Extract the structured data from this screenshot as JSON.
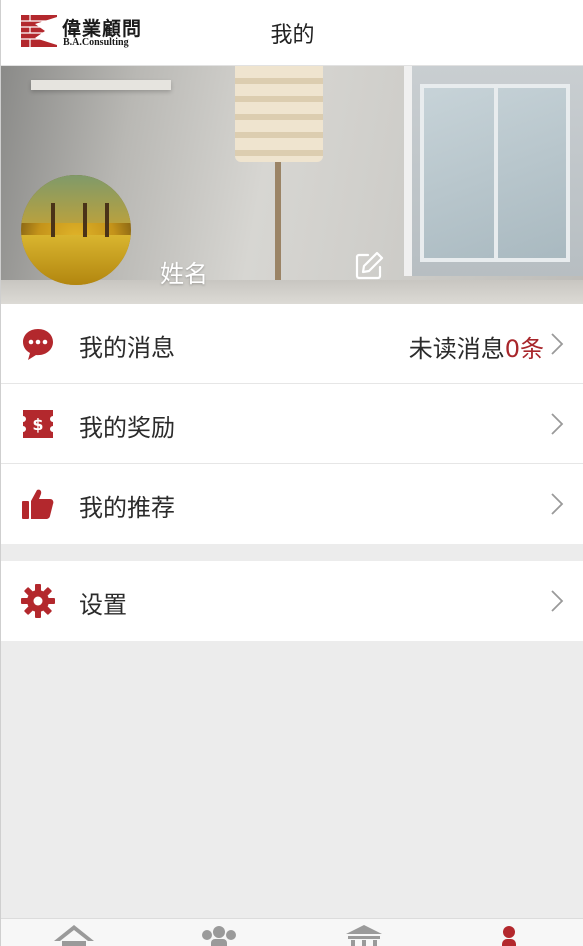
{
  "header": {
    "logo_cn": "偉業顧問",
    "logo_en": "B.A.Consulting",
    "title": "我的"
  },
  "profile": {
    "name": "姓名"
  },
  "menu": [
    {
      "label": "我的消息",
      "extra_text": "未读消息",
      "extra_count": "0条",
      "icon": "chat-bubble-icon"
    },
    {
      "label": "我的奖励",
      "icon": "dollar-ticket-icon"
    },
    {
      "label": "我的推荐",
      "icon": "thumbs-up-icon"
    }
  ],
  "settings": {
    "label": "设置",
    "icon": "gear-icon"
  },
  "tabbar": {
    "tabs": [
      {
        "icon": "home-icon",
        "active": false
      },
      {
        "icon": "group-icon",
        "active": false
      },
      {
        "icon": "bank-icon",
        "active": false
      },
      {
        "icon": "person-icon",
        "active": true
      }
    ]
  },
  "colors": {
    "accent": "#b3282d",
    "inactive_tab": "#9a9a9a",
    "background": "#ececec"
  }
}
